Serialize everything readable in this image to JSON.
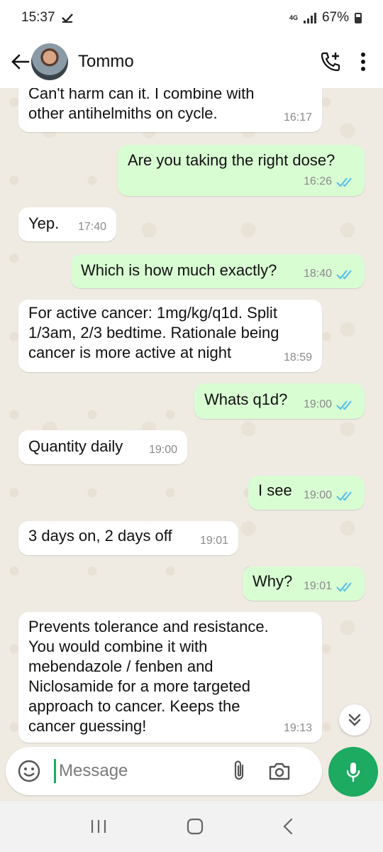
{
  "status_bar": {
    "time": "15:37",
    "network": "4G",
    "battery": "67%"
  },
  "header": {
    "contact_name": "Tommo",
    "icons": [
      "back-arrow-icon",
      "add-call-icon",
      "more-vert-icon"
    ]
  },
  "messages": [
    {
      "dir": "in",
      "text": "Can't harm can it. I combine with\nother antihelmiths on cycle.",
      "time": "16:17"
    },
    {
      "dir": "out",
      "text": "Are you taking the right dose?",
      "time": "16:26"
    },
    {
      "dir": "in",
      "text": "Yep.",
      "time": "17:40"
    },
    {
      "dir": "out",
      "text": "Which is how much exactly?",
      "time": "18:40"
    },
    {
      "dir": "in",
      "text": "For active cancer: 1mg/kg/q1d.  Split\n1/3am, 2/3 bedtime. Rationale being\ncancer is more active at night",
      "time": "18:59"
    },
    {
      "dir": "out",
      "text": "Whats q1d?",
      "time": "19:00"
    },
    {
      "dir": "in",
      "text": "Quantity daily",
      "time": "19:00"
    },
    {
      "dir": "out",
      "text": "I see",
      "time": "19:00"
    },
    {
      "dir": "in",
      "text": "3 days on, 2 days off",
      "time": "19:01"
    },
    {
      "dir": "out",
      "text": "Why?",
      "time": "19:01"
    },
    {
      "dir": "in",
      "text": "Prevents tolerance and resistance.\nYou would combine it with\nmebendazole / fenben and\nNiclosamide for a more targeted\napproach to cancer. Keeps the\ncancer guessing!",
      "time": "19:13"
    }
  ],
  "composer": {
    "placeholder": "Message"
  },
  "colors": {
    "accent": "#1daa61",
    "outgoing_bubble": "#d9fdd3",
    "incoming_bubble": "#ffffff",
    "read_ticks": "#53bdeb",
    "chat_background": "#efeae2"
  }
}
